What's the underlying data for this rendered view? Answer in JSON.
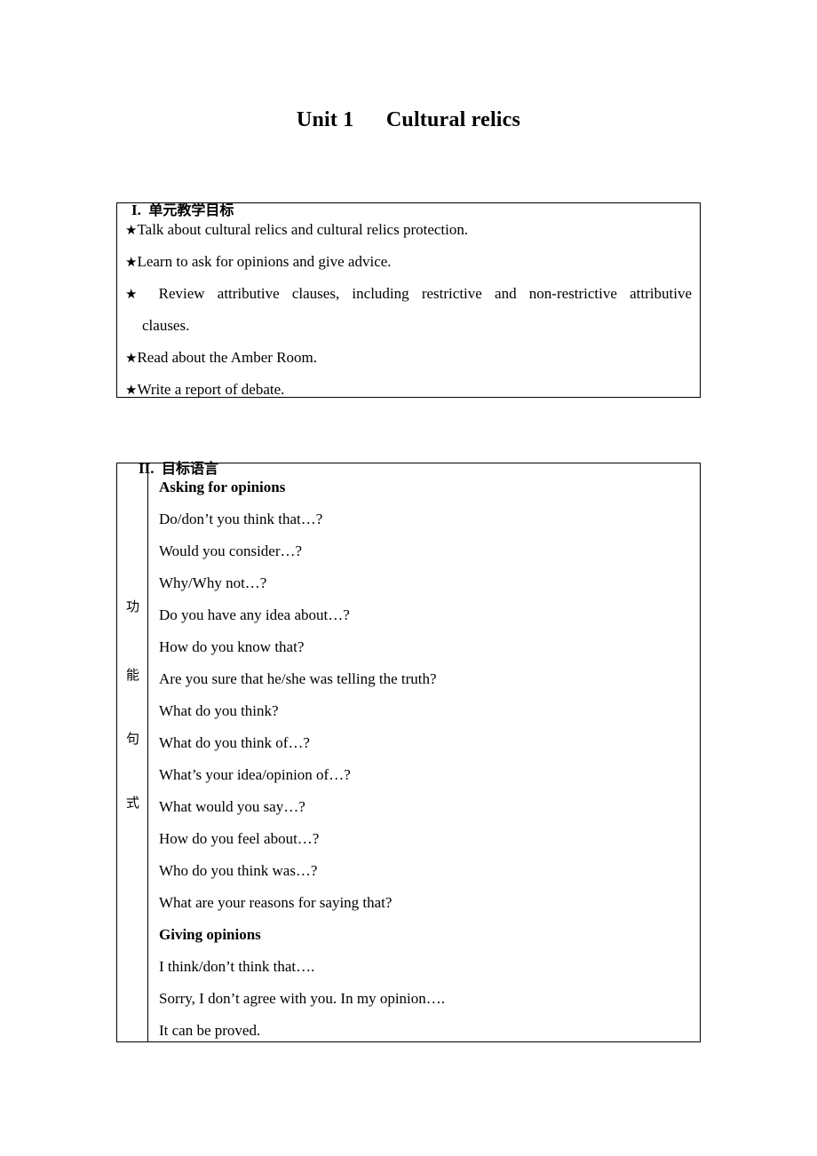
{
  "document": {
    "title": "Unit 1  Cultural relics"
  },
  "sections": [
    {
      "number": "I.",
      "heading_cjk": "单元教学目标",
      "objectives": [
        {
          "bullet": "★",
          "text": "Talk about cultural relics and cultural relics protection.",
          "justified": false
        },
        {
          "bullet": "★",
          "text": "Learn to ask for opinions and give advice.",
          "justified": false
        },
        {
          "bullet": "★",
          "text": "Review attributive clauses, including restrictive and non-restrictive attributive",
          "justified": true
        },
        {
          "bullet": "",
          "text": "clauses.",
          "continuation": true
        },
        {
          "bullet": "★",
          "text": "Read about the Amber Room.",
          "justified": false
        },
        {
          "bullet": "★",
          "text": "Write a report of debate.",
          "justified": false
        }
      ]
    },
    {
      "number": "II.",
      "heading_cjk": "目标语言",
      "label_column": [
        "功",
        "能",
        "句",
        "式"
      ],
      "rows": [
        {
          "text": "Asking for opinions",
          "bold": true
        },
        {
          "text": "Do/don’t you think that…?",
          "bold": false
        },
        {
          "text": "Would you consider…?",
          "bold": false
        },
        {
          "text": "Why/Why not…?",
          "bold": false
        },
        {
          "text": "Do you have any idea about…?",
          "bold": false
        },
        {
          "text": "How do you know that?",
          "bold": false
        },
        {
          "text": "Are you sure that he/she was telling the truth?",
          "bold": false
        },
        {
          "text": "What do you think?",
          "bold": false
        },
        {
          "text": "What do you think of…?",
          "bold": false
        },
        {
          "text": "What’s your idea/opinion of…?",
          "bold": false
        },
        {
          "text": "What would you say…?",
          "bold": false
        },
        {
          "text": "How do you feel about…?",
          "bold": false
        },
        {
          "text": "Who do you think was…?",
          "bold": false
        },
        {
          "text": "What are your reasons for saying that?",
          "bold": false
        },
        {
          "text": "Giving opinions",
          "bold": true
        },
        {
          "text": "I think/don’t think that….",
          "bold": false
        },
        {
          "text": "Sorry, I don’t agree with you. In my opinion….",
          "bold": false
        },
        {
          "text": "It can be proved.",
          "bold": false
        }
      ]
    }
  ]
}
